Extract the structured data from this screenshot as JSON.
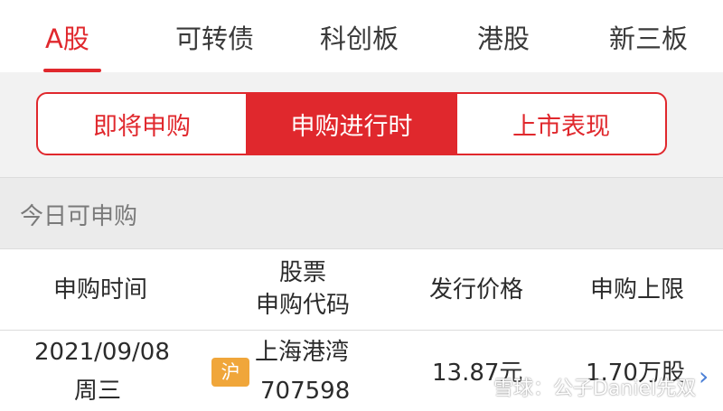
{
  "tabs": [
    "A股",
    "可转债",
    "科创板",
    "港股",
    "新三板"
  ],
  "segments": [
    "即将申购",
    "申购进行时",
    "上市表现"
  ],
  "section": {
    "title": "今日可申购"
  },
  "table": {
    "headers": {
      "time": "申购时间",
      "code_line1": "股票",
      "code_line2": "申购代码",
      "price": "发行价格",
      "limit": "申购上限"
    },
    "rows": [
      {
        "date": "2021/09/08",
        "weekday": "周三",
        "market": "沪",
        "name": "上海港湾",
        "code": "707598",
        "price": "13.87元",
        "limit": "1.70万股"
      }
    ]
  },
  "watermark": "雪球：公子Daniel先双",
  "colors": {
    "accent": "#e0282d",
    "badge": "#f0a63a",
    "chevron": "#4a7fd6"
  },
  "icons": {
    "row_chevron": "chevron-right-icon"
  }
}
